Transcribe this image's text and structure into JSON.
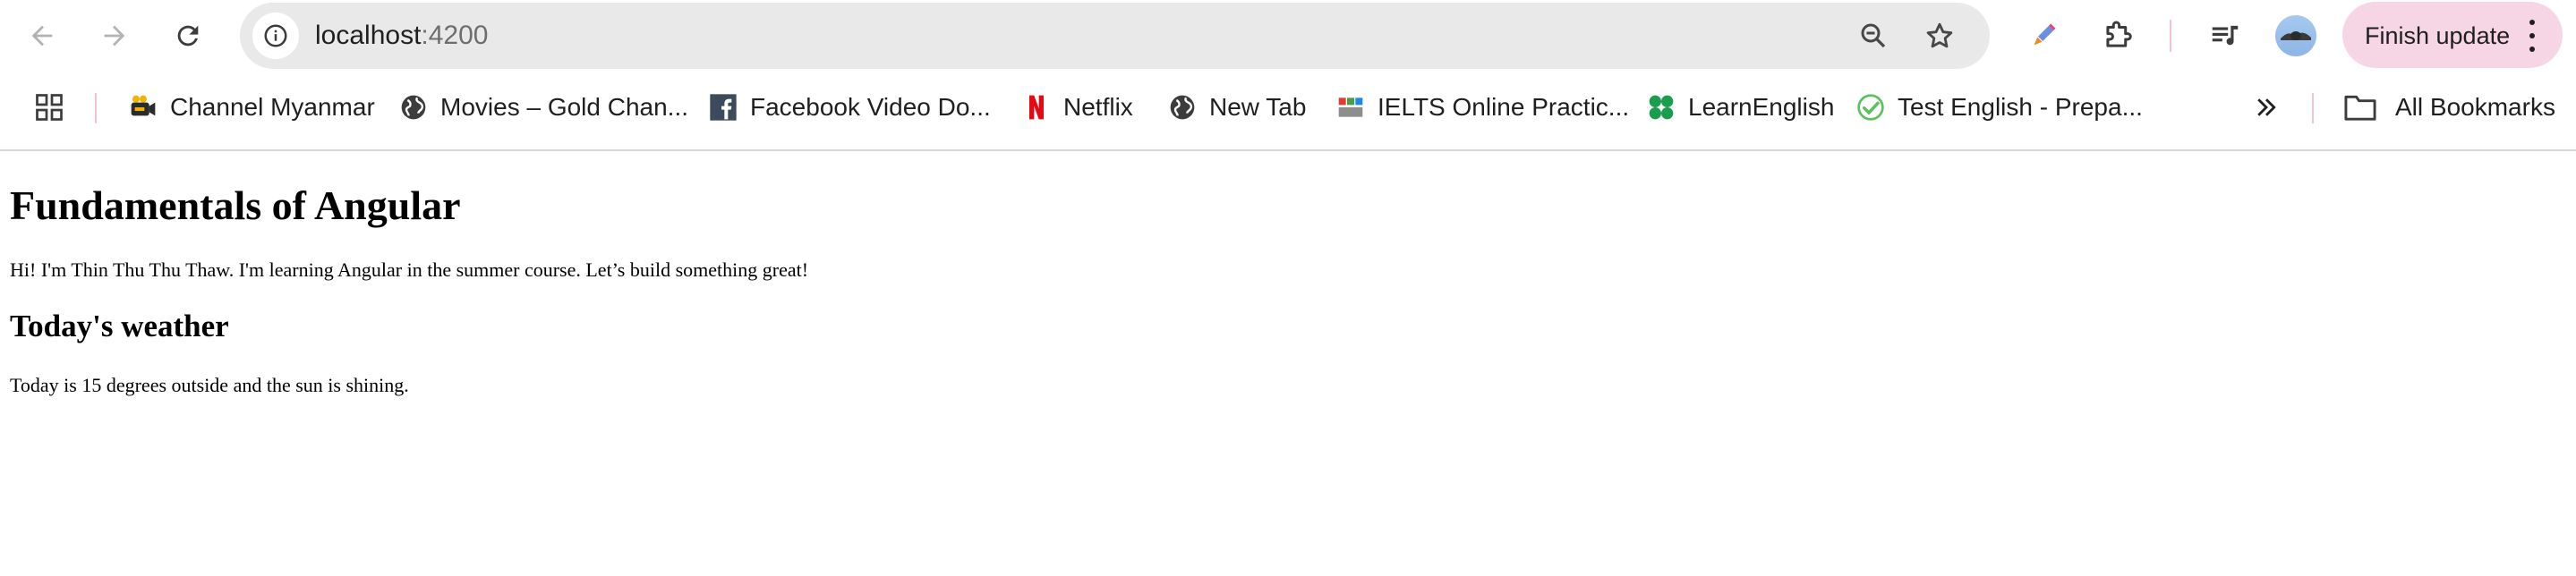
{
  "browser": {
    "url_host": "localhost",
    "url_port": ":4200",
    "finish_update_label": "Finish update",
    "icons": {
      "back": "arrow-left-icon",
      "forward": "arrow-right-icon",
      "reload": "reload-icon",
      "site_info": "info-icon",
      "zoom": "zoom-out-icon",
      "bookmark": "star-icon",
      "pen": "pen-icon",
      "extensions": "puzzle-icon",
      "media": "media-queue-icon",
      "menu": "kebab-icon"
    }
  },
  "bookmarks": {
    "items": [
      {
        "label": "Channel Myanmar",
        "icon": "camera-icon"
      },
      {
        "label": "Movies – Gold Chan...",
        "icon": "globe-icon"
      },
      {
        "label": "Facebook Video Do...",
        "icon": "facebook-icon"
      },
      {
        "label": "Netflix",
        "icon": "netflix-icon"
      },
      {
        "label": "New Tab",
        "icon": "globe-icon"
      },
      {
        "label": "IELTS Online Practic...",
        "icon": "ielts-icon"
      },
      {
        "label": "LearnEnglish",
        "icon": "clover-icon"
      },
      {
        "label": "Test English - Prepa...",
        "icon": "check-icon"
      }
    ],
    "all_bookmarks_label": "All Bookmarks"
  },
  "page": {
    "title": "Fundamentals of Angular",
    "intro": "Hi! I'm Thin Thu Thu Thaw. I'm learning Angular in the summer course. Let’s build something great!",
    "weather_heading": "Today's weather",
    "weather_text": "Today is 15 degrees outside and the sun is shining."
  },
  "colors": {
    "omnibox_bg": "#e9e9e9",
    "finish_update_bg": "#f6d6e4",
    "separator": "#f2c4d3",
    "netflix_red": "#e50914",
    "facebook_bg": "#3b4a5c"
  }
}
